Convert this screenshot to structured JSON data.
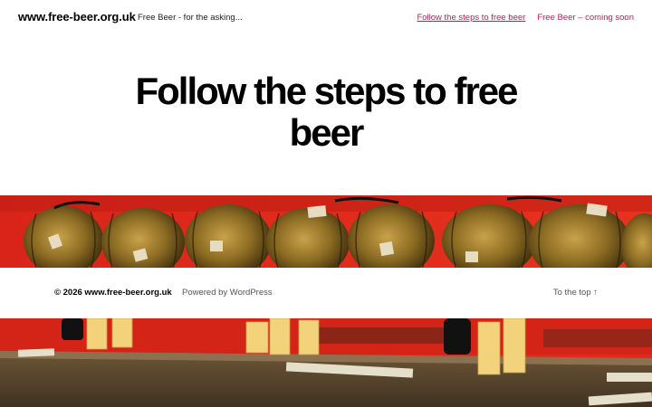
{
  "header": {
    "site_title": "www.free-beer.org.uk",
    "site_description": "Free Beer - for the asking...",
    "nav": [
      {
        "label": "Follow the steps to free beer"
      },
      {
        "label": "Free Beer – coming soon"
      }
    ]
  },
  "main": {
    "heading_line1": "Follow the steps to free",
    "heading_line2": "beer"
  },
  "images": {
    "barrels": "beer barrels on red background",
    "bar": "bar counter with plastic cups"
  },
  "footer": {
    "copyright": "© 2026 www.free-beer.org.uk",
    "powered": "Powered by WordPress",
    "to_top": "To the top ↑"
  },
  "colors": {
    "link": "#c2185b",
    "background": "#ffffff",
    "text": "#000000",
    "image_red": "#e0261a"
  }
}
